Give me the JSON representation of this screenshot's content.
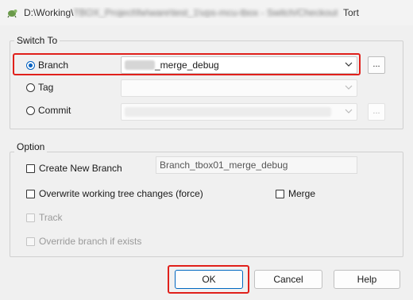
{
  "window": {
    "title_prefix": "D:\\Working\\",
    "title_blurred": "TBOX_Project\\fw\\ware\\test_1\\vps-mcu-tbox - Switch/Checkout",
    "title_suffix": "Tort"
  },
  "switch_to": {
    "label": "Switch To",
    "branch_label": "Branch",
    "branch_value": "_merge_debug",
    "tag_label": "Tag",
    "commit_label": "Commit",
    "browse_label": "..."
  },
  "option": {
    "label": "Option",
    "create_new_branch": "Create New Branch",
    "new_branch_name": "Branch_tbox01_merge_debug",
    "overwrite": "Overwrite working tree changes (force)",
    "merge": "Merge",
    "track": "Track",
    "override": "Override branch if exists"
  },
  "buttons": {
    "ok": "OK",
    "cancel": "Cancel",
    "help": "Help"
  },
  "highlight_color": "#e0201b",
  "accent_color": "#0067c0"
}
